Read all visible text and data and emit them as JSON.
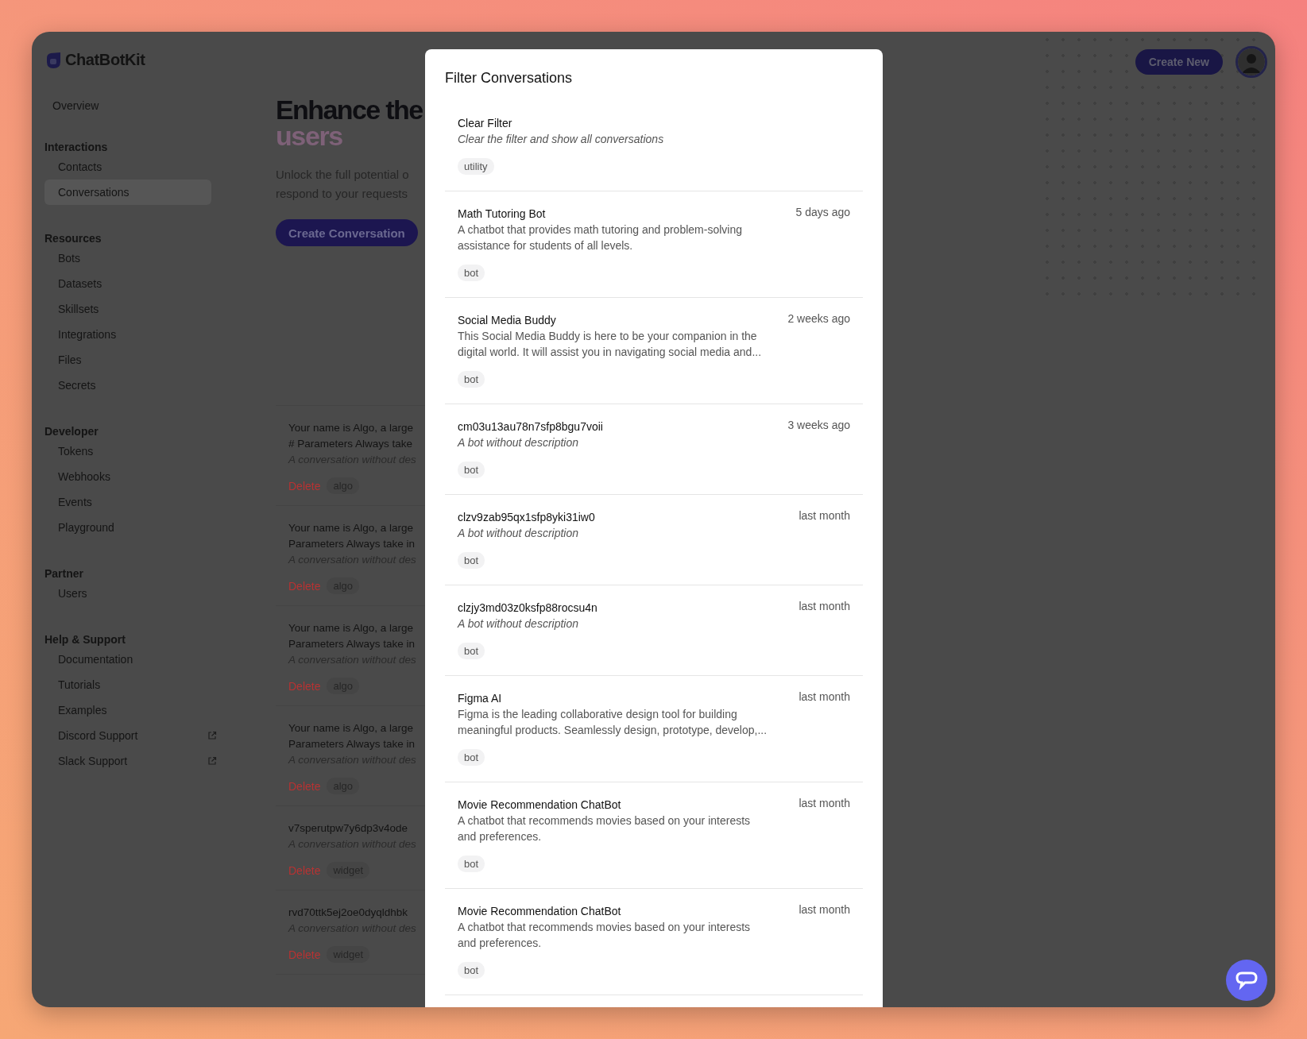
{
  "brand": {
    "name": "ChatBotKit"
  },
  "sidebar": {
    "top_item": {
      "label": "Overview",
      "selected": false
    },
    "sections": [
      {
        "title": "Interactions",
        "items": [
          {
            "label": "Contacts",
            "selected": false,
            "external": false
          },
          {
            "label": "Conversations",
            "selected": true,
            "external": false
          }
        ]
      },
      {
        "title": "Resources",
        "items": [
          {
            "label": "Bots",
            "selected": false,
            "external": false
          },
          {
            "label": "Datasets",
            "selected": false,
            "external": false
          },
          {
            "label": "Skillsets",
            "selected": false,
            "external": false
          },
          {
            "label": "Integrations",
            "selected": false,
            "external": false
          },
          {
            "label": "Files",
            "selected": false,
            "external": false
          },
          {
            "label": "Secrets",
            "selected": false,
            "external": false
          }
        ]
      },
      {
        "title": "Developer",
        "items": [
          {
            "label": "Tokens",
            "selected": false,
            "external": false
          },
          {
            "label": "Webhooks",
            "selected": false,
            "external": false
          },
          {
            "label": "Events",
            "selected": false,
            "external": false
          },
          {
            "label": "Playground",
            "selected": false,
            "external": false
          }
        ]
      },
      {
        "title": "Partner",
        "items": [
          {
            "label": "Users",
            "selected": false,
            "external": false
          }
        ]
      },
      {
        "title": "Help & Support",
        "items": [
          {
            "label": "Documentation",
            "selected": false,
            "external": false
          },
          {
            "label": "Tutorials",
            "selected": false,
            "external": false
          },
          {
            "label": "Examples",
            "selected": false,
            "external": false
          },
          {
            "label": "Discord Support",
            "selected": false,
            "external": true
          },
          {
            "label": "Slack Support",
            "selected": false,
            "external": true
          }
        ]
      }
    ]
  },
  "header": {
    "create_button": "Create New"
  },
  "hero": {
    "title": "Enhance the",
    "title_accent": "users",
    "description": [
      "Unlock the full potential o",
      "respond to your requests"
    ],
    "button": "Create Conversation"
  },
  "conversations": [
    {
      "title": [
        "Your name is Algo, a large",
        "# Parameters Always take"
      ],
      "description": "A conversation without des",
      "delete": "Delete",
      "tag": "algo"
    },
    {
      "title": [
        "Your name is Algo, a large",
        "Parameters Always take in"
      ],
      "description": "A conversation without des",
      "delete": "Delete",
      "tag": "algo"
    },
    {
      "title": [
        "Your name is Algo, a large",
        "Parameters Always take in"
      ],
      "description": "A conversation without des",
      "delete": "Delete",
      "tag": "algo"
    },
    {
      "title": [
        "Your name is Algo, a large",
        "Parameters Always take in"
      ],
      "description": "A conversation without des",
      "delete": "Delete",
      "tag": "algo"
    },
    {
      "title": [
        "v7sperutpw7y6dp3v4ode"
      ],
      "description": "A conversation without des",
      "delete": "Delete",
      "tag": "widget"
    },
    {
      "title": [
        "rvd70ttk5ej2oe0dyqldhbk"
      ],
      "description": "A conversation without des",
      "delete": "Delete",
      "tag": "widget"
    }
  ],
  "filter_dialog": {
    "title": "Filter Conversations",
    "items": [
      {
        "title": "Clear Filter",
        "description": [
          "Clear the filter and show all conversations"
        ],
        "empty_description": true,
        "tag": "utility"
      },
      {
        "title": "Math Tutoring Bot",
        "time": "5 days ago",
        "description": [
          "A chatbot that provides math tutoring and problem-solving",
          "assistance for students of all levels."
        ],
        "empty_description": false,
        "tag": "bot"
      },
      {
        "title": "Social Media Buddy",
        "time": "2 weeks ago",
        "description": [
          "This Social Media Buddy is here to be your companion in the",
          "digital world. It will assist you in navigating social media and..."
        ],
        "empty_description": false,
        "tag": "bot"
      },
      {
        "title": "cm03u13au78n7sfp8bgu7voii",
        "time": "3 weeks ago",
        "description": [
          "A bot without description"
        ],
        "empty_description": true,
        "tag": "bot"
      },
      {
        "title": "clzv9zab95qx1sfp8yki31iw0",
        "time": "last month",
        "description": [
          "A bot without description"
        ],
        "empty_description": true,
        "tag": "bot"
      },
      {
        "title": "clzjy3md03z0ksfp88rocsu4n",
        "time": "last month",
        "description": [
          "A bot without description"
        ],
        "empty_description": true,
        "tag": "bot"
      },
      {
        "title": "Figma AI",
        "time": "last month",
        "description": [
          "Figma is the leading collaborative design tool for building",
          "meaningful products. Seamlessly design, prototype, develop,..."
        ],
        "empty_description": false,
        "tag": "bot"
      },
      {
        "title": "Movie Recommendation ChatBot",
        "time": "last month",
        "description": [
          "A chatbot that recommends movies based on your interests",
          "and preferences."
        ],
        "empty_description": false,
        "tag": "bot"
      },
      {
        "title": "Movie Recommendation ChatBot",
        "time": "last month",
        "description": [
          "A chatbot that recommends movies based on your interests",
          "and preferences."
        ],
        "empty_description": false,
        "tag": "bot"
      }
    ]
  }
}
